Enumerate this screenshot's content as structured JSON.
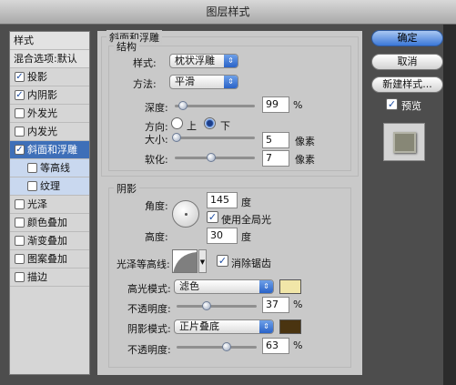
{
  "window": {
    "title": "图层样式"
  },
  "sidebar": {
    "header": "样式",
    "blend_options": "混合选项:默认",
    "items": [
      {
        "label": "投影",
        "checked": true,
        "selected": false,
        "sub": false
      },
      {
        "label": "内阴影",
        "checked": true,
        "selected": false,
        "sub": false
      },
      {
        "label": "外发光",
        "checked": false,
        "selected": false,
        "sub": false
      },
      {
        "label": "内发光",
        "checked": false,
        "selected": false,
        "sub": false
      },
      {
        "label": "斜面和浮雕",
        "checked": true,
        "selected": true,
        "sub": false
      },
      {
        "label": "等高线",
        "checked": false,
        "selected": false,
        "sub": true
      },
      {
        "label": "纹理",
        "checked": false,
        "selected": false,
        "sub": true
      },
      {
        "label": "光泽",
        "checked": false,
        "selected": false,
        "sub": false
      },
      {
        "label": "颜色叠加",
        "checked": false,
        "selected": false,
        "sub": false
      },
      {
        "label": "渐变叠加",
        "checked": false,
        "selected": false,
        "sub": false
      },
      {
        "label": "图案叠加",
        "checked": false,
        "selected": false,
        "sub": false
      },
      {
        "label": "描边",
        "checked": false,
        "selected": false,
        "sub": false
      }
    ]
  },
  "bevel": {
    "section_title": "斜面和浮雕",
    "structure_title": "结构",
    "style_label": "样式:",
    "style_value": "枕状浮雕",
    "method_label": "方法:",
    "method_value": "平滑",
    "depth_label": "深度:",
    "depth_value": "99",
    "depth_unit": "%",
    "depth_level": 0.1,
    "direction_label": "方向:",
    "direction_up": "上",
    "direction_down": "下",
    "direction_selected": "下",
    "size_label": "大小:",
    "size_value": "5",
    "size_unit": "像素",
    "size_level": 0.02,
    "soften_label": "软化:",
    "soften_value": "7",
    "soften_unit": "像素",
    "soften_level": 0.45
  },
  "shading": {
    "title": "阴影",
    "angle_label": "角度:",
    "angle_value": "145",
    "angle_unit": "度",
    "global_light_label": "使用全局光",
    "global_light_checked": true,
    "altitude_label": "高度:",
    "altitude_value": "30",
    "altitude_unit": "度",
    "gloss_contour_label": "光泽等高线:",
    "anti_alias_label": "消除锯齿",
    "anti_alias_checked": true,
    "highlight_mode_label": "高光模式:",
    "highlight_mode_value": "滤色",
    "highlight_color": "#f1e6a8",
    "highlight_opacity_label": "不透明度:",
    "highlight_opacity_value": "37",
    "highlight_opacity_unit": "%",
    "highlight_opacity_level": 0.37,
    "shadow_mode_label": "阴影模式:",
    "shadow_mode_value": "正片叠底",
    "shadow_color": "#4a3410",
    "shadow_opacity_label": "不透明度:",
    "shadow_opacity_value": "63",
    "shadow_opacity_unit": "%",
    "shadow_opacity_level": 0.63
  },
  "buttons": {
    "ok": "确定",
    "cancel": "取消",
    "new_style": "新建样式...",
    "preview_label": "预览",
    "preview_checked": true
  }
}
